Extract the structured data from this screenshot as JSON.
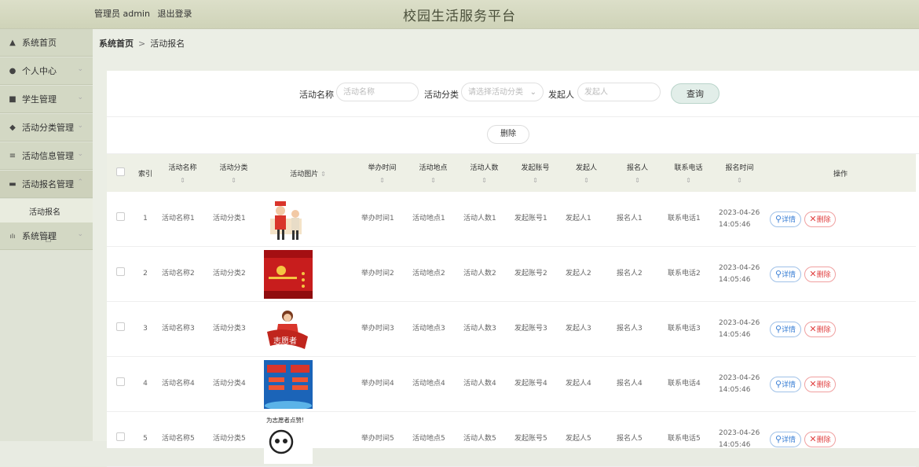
{
  "topbar": {
    "user": "管理员 admin",
    "logout": "退出登录",
    "title": "校园生活服务平台"
  },
  "sidebar": {
    "items": [
      {
        "icon": "home-icon",
        "glyph": "▲",
        "label": "系统首页"
      },
      {
        "icon": "user-icon",
        "glyph": "●",
        "label": "个人中心"
      },
      {
        "icon": "student-icon",
        "glyph": "■",
        "label": "学生管理"
      },
      {
        "icon": "category-icon",
        "glyph": "◆",
        "label": "活动分类管理"
      },
      {
        "icon": "info-icon",
        "glyph": "≡",
        "label": "活动信息管理"
      },
      {
        "icon": "signup-icon",
        "glyph": "▬",
        "label": "活动报名管理"
      }
    ],
    "sub": "活动报名",
    "system": {
      "icon": "chart-icon",
      "glyph": "ılı",
      "label": "系统管理"
    }
  },
  "breadcrumb": {
    "home": "系统首页",
    "sep": ">",
    "current": "活动报名"
  },
  "search": {
    "name_label": "活动名称",
    "name_placeholder": "活动名称",
    "cat_label": "活动分类",
    "cat_placeholder": "请选择活动分类",
    "org_label": "发起人",
    "org_placeholder": "发起人",
    "query": "查询"
  },
  "delete_batch": "删除",
  "table": {
    "headers": [
      "索引",
      "活动名称",
      "活动分类",
      "活动图片",
      "举办时间",
      "活动地点",
      "活动人数",
      "发起账号",
      "发起人",
      "报名人",
      "联系电话",
      "报名时间",
      "操作"
    ],
    "sort_glyph": "⇕",
    "detail_label": "详情",
    "delete_label": "删除",
    "rows": [
      {
        "idx": "1",
        "name": "活动名称1",
        "cat": "活动分类1",
        "time": "举办时间1",
        "place": "活动地点1",
        "num": "活动人数1",
        "acct": "发起账号1",
        "org": "发起人1",
        "applicant": "报名人1",
        "phone": "联系电话1",
        "signup": "2023-04-26 14:05:46"
      },
      {
        "idx": "2",
        "name": "活动名称2",
        "cat": "活动分类2",
        "time": "举办时间2",
        "place": "活动地点2",
        "num": "活动人数2",
        "acct": "发起账号2",
        "org": "发起人2",
        "applicant": "报名人2",
        "phone": "联系电话2",
        "signup": "2023-04-26 14:05:46"
      },
      {
        "idx": "3",
        "name": "活动名称3",
        "cat": "活动分类3",
        "time": "举办时间3",
        "place": "活动地点3",
        "num": "活动人数3",
        "acct": "发起账号3",
        "org": "发起人3",
        "applicant": "报名人3",
        "phone": "联系电话3",
        "signup": "2023-04-26 14:05:46"
      },
      {
        "idx": "4",
        "name": "活动名称4",
        "cat": "活动分类4",
        "time": "举办时间4",
        "place": "活动地点4",
        "num": "活动人数4",
        "acct": "发起账号4",
        "org": "发起人4",
        "applicant": "报名人4",
        "phone": "联系电话4",
        "signup": "2023-04-26 14:05:46"
      },
      {
        "idx": "5",
        "name": "活动名称5",
        "cat": "活动分类5",
        "time": "举办时间5",
        "place": "活动地点5",
        "num": "活动人数5",
        "acct": "发起账号5",
        "org": "发起人5",
        "applicant": "报名人5",
        "phone": "联系电话5",
        "signup": "2023-04-26 14:05:46"
      }
    ],
    "image_captions": [
      "志愿者",
      "为志愿者点赞!"
    ]
  }
}
